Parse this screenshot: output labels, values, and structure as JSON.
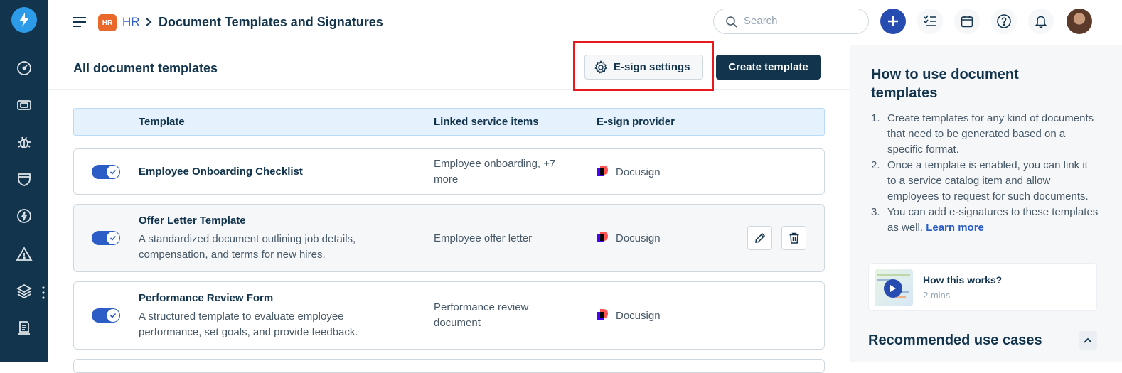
{
  "header": {
    "module_badge": "HR",
    "breadcrumb_module": "HR",
    "page_title": "Document Templates and Signatures",
    "search_placeholder": "Search"
  },
  "sidebar": {
    "icons": [
      "dashboard-icon",
      "tickets-icon",
      "problems-icon",
      "changes-icon",
      "releases-icon",
      "alerts-icon",
      "assets-icon",
      "solutions-icon"
    ]
  },
  "main": {
    "section_title": "All document templates",
    "esign_settings_label": "E-sign settings",
    "create_template_label": "Create template",
    "columns": [
      "Template",
      "Linked service items",
      "E-sign provider"
    ],
    "rows": [
      {
        "enabled": true,
        "name": "Employee Onboarding Checklist",
        "description": "",
        "linked": "Employee onboarding, +7 more",
        "provider": "Docusign"
      },
      {
        "enabled": true,
        "name": "Offer Letter Template",
        "description": "A standardized document outlining job details, compensation, and terms for new hires.",
        "linked": "Employee offer letter",
        "provider": "Docusign"
      },
      {
        "enabled": true,
        "name": "Performance Review Form",
        "description": "A structured template to evaluate employee performance, set goals, and provide feedback.",
        "linked": "Performance review document",
        "provider": "Docusign"
      }
    ]
  },
  "help_panel": {
    "title": "How to use document templates",
    "steps": [
      "Create templates for any kind of documents that need to be generated based on a specific format.",
      "Once a template is enabled, you can link it to a service catalog item and allow employees to request for such documents.",
      "You can add e-signatures to these templates as well."
    ],
    "learn_more": "Learn more",
    "video_title": "How this works?",
    "video_duration": "2 mins",
    "recommended_title": "Recommended use cases"
  },
  "colors": {
    "sidebar": "#12344d",
    "primary_button": "#12344d",
    "accent_blue": "#264bb1",
    "badge_orange": "#e9692c",
    "highlight_red": "#e8191a",
    "table_header_bg": "#e5f2fd"
  }
}
